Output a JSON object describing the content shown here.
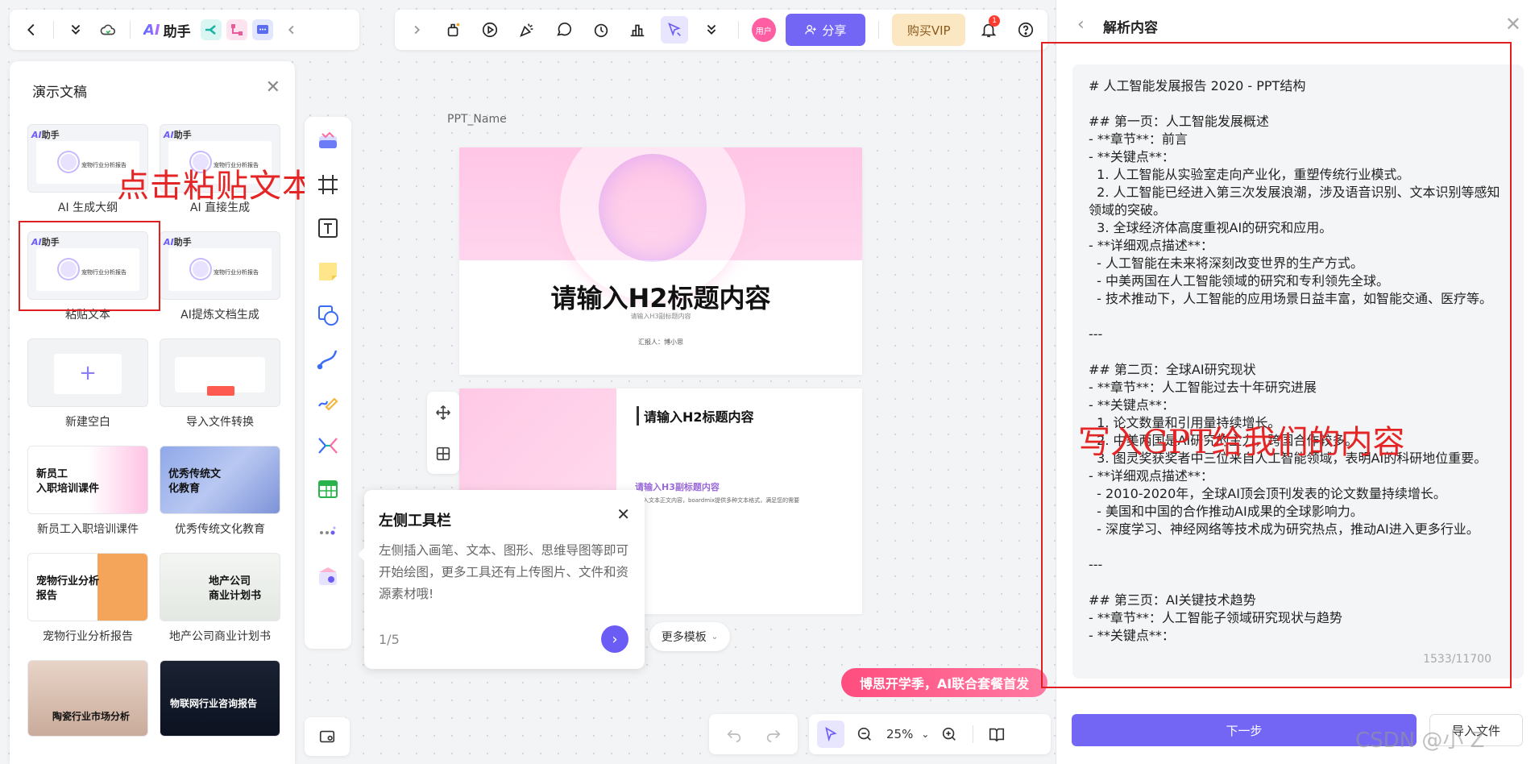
{
  "top_left": {
    "ai_brand_mark": "AI",
    "ai_brand_label": "助手"
  },
  "top_main": {
    "avatar_label": "用户",
    "share_label": "分享",
    "vip_label": "购买VIP",
    "notification_count": "1"
  },
  "left_panel": {
    "title": "演示文稿",
    "cards": [
      {
        "label": "AI 生成大纲",
        "thumb_text": "宠物行业分析报告"
      },
      {
        "label": "AI 直接生成",
        "thumb_text": "宠物行业分析报告"
      },
      {
        "label": "粘贴文本",
        "thumb_text": "宠物行业分析报告"
      },
      {
        "label": "AI提炼文档生成",
        "thumb_text": "宠物行业分析报告"
      },
      {
        "label": "新建空白"
      },
      {
        "label": "导入文件转换"
      },
      {
        "label": "新员工入职培训课件",
        "thumb_text": "新员工\n入职培训课件"
      },
      {
        "label": "优秀传统文化教育",
        "thumb_text": "优秀传统文\n化教育"
      },
      {
        "label": "宠物行业分析报告",
        "thumb_text": "宠物行业分析\n报告"
      },
      {
        "label": "地产公司商业计划书",
        "thumb_text": "地产公司\n商业计划书"
      },
      {
        "label": "",
        "thumb_text": "陶瓷行业市场分析"
      },
      {
        "label": "",
        "thumb_text": "物联网行业咨询报告"
      }
    ],
    "annotation": "点击粘贴文本"
  },
  "canvas": {
    "ppt_name": "PPT_Name",
    "slide1": {
      "title": "请输入H2标题内容",
      "subtitle": "请输入H3副标题内容",
      "reporter": "汇报人：博小思"
    },
    "slide2": {
      "title": "请输入H2标题内容",
      "h3": "请输入H3副标题内容",
      "text": "入文本正文内容，boardmix提供多种文本格式，满足您的需要"
    },
    "more_templates": "更多模板"
  },
  "tooltip": {
    "title": "左侧工具栏",
    "body": "左侧插入画笔、文本、图形、思维导图等即可开始绘图，更多工具还有上传图片、文件和资源素材哦!",
    "page": "1/5"
  },
  "promo": "博思开学季，AI联合套餐首发",
  "zoom": "25%",
  "right_panel": {
    "title": "解析内容",
    "content": "# 人工智能发展报告 2020 - PPT结构\n\n## 第一页：人工智能发展概述\n- **章节**：前言\n- **关键点**：\n  1. 人工智能从实验室走向产业化，重塑传统行业模式。\n  2. 人工智能已经进入第三次发展浪潮，涉及语音识别、文本识别等感知领域的突破。\n  3. 全球经济体高度重视AI的研究和应用。\n- **详细观点描述**：\n  - 人工智能在未来将深刻改变世界的生产方式。\n  - 中美两国在人工智能领域的研究和专利领先全球。\n  - 技术推动下，人工智能的应用场景日益丰富，如智能交通、医疗等。\n\n---\n\n## 第二页：全球AI研究现状\n- **章节**：人工智能过去十年研究进展\n- **关键点**：\n  1. 论文数量和引用量持续增长。\n  2. 中美两国是AI研究的主力，跨国合作较多。\n  3. 图灵奖获奖者中三位来自人工智能领域，表明AI的科研地位重要。\n- **详细观点描述**：\n  - 2010-2020年，全球AI顶会顶刊发表的论文数量持续增长。\n  - 美国和中国的合作推动AI成果的全球影响力。\n  - 深度学习、神经网络等技术成为研究热点，推动AI进入更多行业。\n\n---\n\n## 第三页：AI关键技术趋势\n- **章节**：人工智能子领域研究现状与趋势\n- **关键点**：",
    "char_count": "1533/11700",
    "annotation": "写入GPT给我们的内容",
    "next_label": "下一步",
    "import_label": "导入文件"
  },
  "watermark": "CSDN @小 Z",
  "colors": {
    "accent": "#7366f5",
    "annotation_red": "#e02020",
    "promo_pink": "#ff4d7e"
  }
}
